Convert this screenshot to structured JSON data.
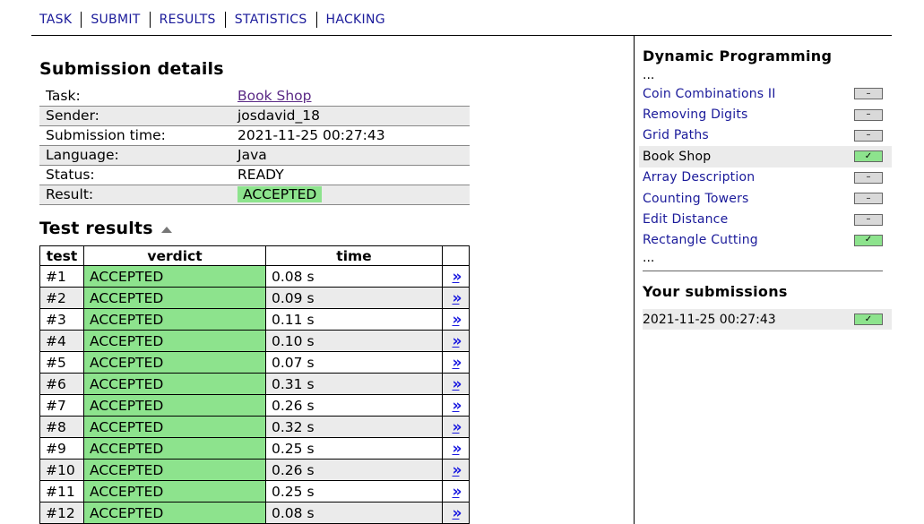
{
  "nav": [
    "TASK",
    "SUBMIT",
    "RESULTS",
    "STATISTICS",
    "HACKING"
  ],
  "submission": {
    "title": "Submission details",
    "rows": [
      {
        "label": "Task:",
        "value": "Book Shop",
        "link": true
      },
      {
        "label": "Sender:",
        "value": "josdavid_18"
      },
      {
        "label": "Submission time:",
        "value": "2021-11-25 00:27:43"
      },
      {
        "label": "Language:",
        "value": "Java"
      },
      {
        "label": "Status:",
        "value": "READY"
      },
      {
        "label": "Result:",
        "value": "ACCEPTED",
        "badge": true
      }
    ]
  },
  "tests": {
    "title": "Test results",
    "headers": [
      "test",
      "verdict",
      "time"
    ],
    "arrow": "»",
    "rows": [
      {
        "test": "#1",
        "verdict": "ACCEPTED",
        "time": "0.08 s"
      },
      {
        "test": "#2",
        "verdict": "ACCEPTED",
        "time": "0.09 s"
      },
      {
        "test": "#3",
        "verdict": "ACCEPTED",
        "time": "0.11 s"
      },
      {
        "test": "#4",
        "verdict": "ACCEPTED",
        "time": "0.10 s"
      },
      {
        "test": "#5",
        "verdict": "ACCEPTED",
        "time": "0.07 s"
      },
      {
        "test": "#6",
        "verdict": "ACCEPTED",
        "time": "0.31 s"
      },
      {
        "test": "#7",
        "verdict": "ACCEPTED",
        "time": "0.26 s"
      },
      {
        "test": "#8",
        "verdict": "ACCEPTED",
        "time": "0.32 s"
      },
      {
        "test": "#9",
        "verdict": "ACCEPTED",
        "time": "0.25 s"
      },
      {
        "test": "#10",
        "verdict": "ACCEPTED",
        "time": "0.26 s"
      },
      {
        "test": "#11",
        "verdict": "ACCEPTED",
        "time": "0.25 s"
      },
      {
        "test": "#12",
        "verdict": "ACCEPTED",
        "time": "0.08 s"
      }
    ]
  },
  "sidebar": {
    "title": "Dynamic Programming",
    "ellipsis": "...",
    "items": [
      {
        "label": "Coin Combinations II",
        "status": "–",
        "solved": false,
        "current": false
      },
      {
        "label": "Removing Digits",
        "status": "–",
        "solved": false,
        "current": false
      },
      {
        "label": "Grid Paths",
        "status": "–",
        "solved": false,
        "current": false
      },
      {
        "label": "Book Shop",
        "status": "✓",
        "solved": true,
        "current": true
      },
      {
        "label": "Array Description",
        "status": "–",
        "solved": false,
        "current": false
      },
      {
        "label": "Counting Towers",
        "status": "–",
        "solved": false,
        "current": false
      },
      {
        "label": "Edit Distance",
        "status": "–",
        "solved": false,
        "current": false
      },
      {
        "label": "Rectangle Cutting",
        "status": "✓",
        "solved": true,
        "current": false
      }
    ],
    "submissions_title": "Your submissions",
    "submissions": [
      {
        "time": "2021-11-25 00:27:43",
        "status": "✓"
      }
    ]
  },
  "colors": {
    "accepted": "#8de38d",
    "link": "#1a1a9a",
    "visited": "#5b2a86",
    "stripe": "#ebebeb"
  }
}
